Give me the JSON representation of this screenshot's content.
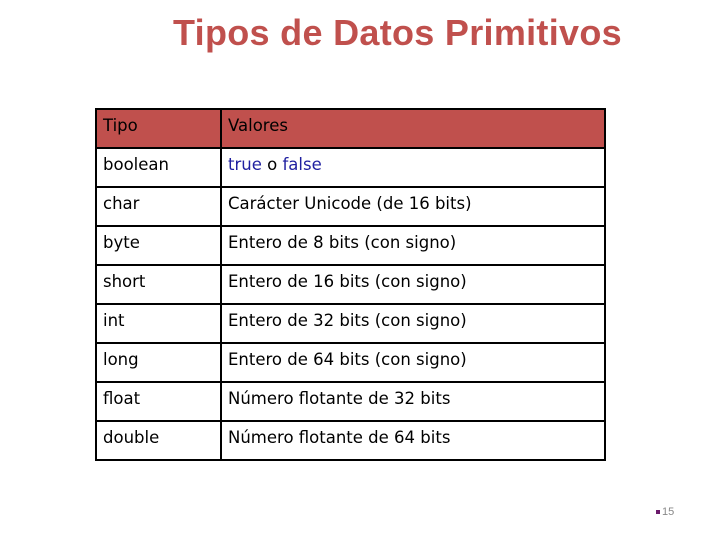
{
  "slide": {
    "title": "Tipos de Datos Primitivos",
    "page_number": "15"
  },
  "table": {
    "headers": [
      "Tipo",
      "Valores"
    ],
    "rows": [
      {
        "type": "boolean",
        "value_parts": [
          "true",
          " o ",
          "false"
        ]
      },
      {
        "type": "char",
        "value": "Carácter Unicode (de 16 bits)"
      },
      {
        "type": "byte",
        "value": "Entero de 8 bits (con signo)"
      },
      {
        "type": "short",
        "value": "Entero de 16 bits (con signo)"
      },
      {
        "type": "int",
        "value": "Entero de 32 bits (con signo)"
      },
      {
        "type": "long",
        "value": "Entero de 64 bits (con signo)"
      },
      {
        "type": "float",
        "value": "Número flotante de 32 bits"
      },
      {
        "type": "double",
        "value": "Número flotante de 64 bits"
      }
    ]
  },
  "colors": {
    "accent": "#c0504d",
    "keyword": "#1f1fa0"
  }
}
